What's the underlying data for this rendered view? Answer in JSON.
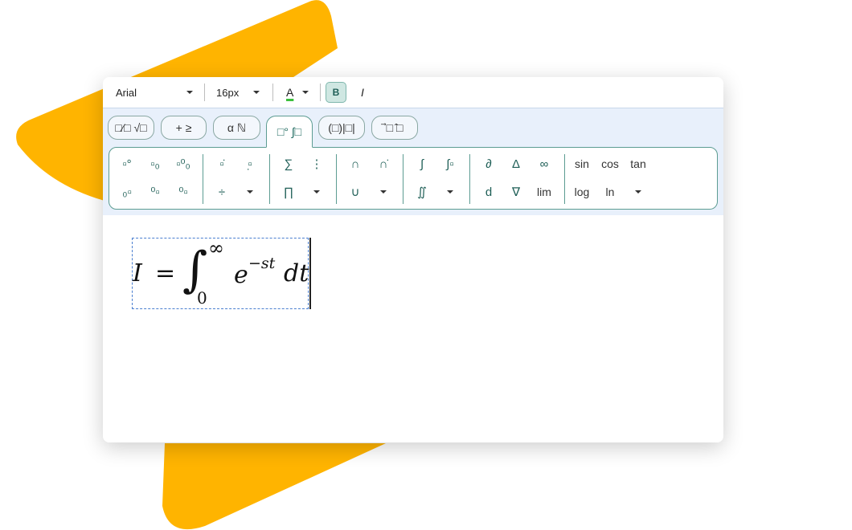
{
  "toolbar": {
    "font": "Arial",
    "font_size": "16px",
    "color_label": "A",
    "bold_label": "B",
    "italic_label": "I"
  },
  "tabs": [
    {
      "label": "□⁄□ √□"
    },
    {
      "label": "+ ≥"
    },
    {
      "label": "α ℕ"
    },
    {
      "label": "□° ∫□"
    },
    {
      "label": "(□)|□|"
    },
    {
      "label": "⃗□ ̂□"
    }
  ],
  "symbols": {
    "sum": "∑",
    "product": "∏",
    "intersection": "∩",
    "union": "∪",
    "integral": "∫",
    "double_integral": "∬",
    "contour_integral": "∮",
    "partial": "∂",
    "delta": "Δ",
    "infinity": "∞",
    "differential": "d",
    "nabla": "∇",
    "lim": "lim",
    "sin": "sin",
    "cos": "cos",
    "tan": "tan",
    "log": "log",
    "ln": "ln"
  },
  "formula": {
    "lhs": "I",
    "equals": "=",
    "integral_sign": "∫",
    "upper_limit": "∞",
    "lower_limit": "0",
    "base": "e",
    "exponent": "−st",
    "differential": "dt"
  },
  "colors": {
    "accent": "#FFB400",
    "teal": "#5C9C92",
    "panel_bg": "#E8F0FB"
  }
}
